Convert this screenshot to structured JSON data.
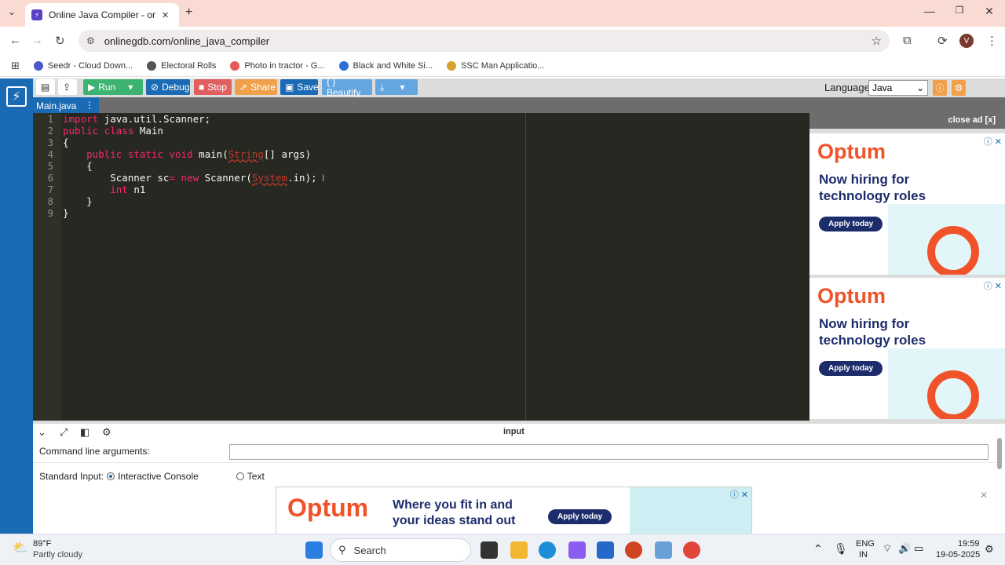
{
  "browser": {
    "tab_title": "Online Java Compiler - online e",
    "tab_close": "✕",
    "new_tab": "+",
    "url": "onlinegdb.com/online_java_compiler",
    "profile_initial": "V",
    "bookmarks": [
      {
        "label": "Seedr - Cloud Down...",
        "color": "#4a57c8"
      },
      {
        "label": "Electoral Rolls",
        "color": "#555555"
      },
      {
        "label": "Photo in tractor - G...",
        "color": "#e85a5a"
      },
      {
        "label": "Black and White Si...",
        "color": "#2a6fd6"
      },
      {
        "label": "SSC Man Applicatio...",
        "color": "#d6a12a"
      }
    ]
  },
  "ide": {
    "buttons": {
      "run": "Run",
      "debug": "Debug",
      "stop": "Stop",
      "share": "Share",
      "save": "Save",
      "beautify": "{ } Beautify"
    },
    "language_label": "Language",
    "language_value": "Java",
    "file_tab": "Main.java",
    "line_numbers": [
      "1",
      "2",
      "3",
      "4",
      "5",
      "6",
      "7",
      "8",
      "9"
    ],
    "code": {
      "l1_kw": "import",
      "l1_rest": " java.util.Scanner;",
      "l2_kw1": "public",
      "l2_kw2": " class",
      "l2_rest": " Main",
      "l3": "{",
      "l4_kw": "    public static void",
      "l4_fn": " main(",
      "l4_bad": "String",
      "l4_rest": "[] args)",
      "l5": "    {",
      "l6_a": "        Scanner sc",
      "l6_op": "=",
      "l6_kw": " new",
      "l6_b": " Scanner(",
      "l6_bad": "System",
      "l6_c": ".in);",
      "l7_kw": "        int",
      "l7_rest": " n1",
      "l8": "    }",
      "l9": "}"
    }
  },
  "ads": {
    "close_ad": "close ad [x]",
    "side": [
      {
        "brand": "Optum",
        "text": "Now hiring for technology roles",
        "cta": "Apply today"
      },
      {
        "brand": "Optum",
        "text": "Now hiring for technology roles",
        "cta": "Apply today"
      }
    ],
    "bottom": {
      "brand": "Optum",
      "text": "Where you fit in and your ideas stand out",
      "cta": "Apply today"
    }
  },
  "panel": {
    "title": "input",
    "cmd_label": "Command line arguments:",
    "cmd_value": "",
    "std_label": "Standard Input:",
    "opt_interactive": "Interactive Console",
    "opt_text": "Text"
  },
  "taskbar": {
    "temp": "89°F",
    "weather": "Partly cloudy",
    "search": "Search",
    "lang1": "ENG",
    "lang2": "IN",
    "time": "19:59",
    "date": "19-05-2025"
  },
  "colors": {
    "accent_blue": "#1a6bb3",
    "run_green": "#3cb371",
    "stop_red": "#e06060",
    "share_orange": "#f0a04a",
    "optum_orange": "#f0532a"
  }
}
